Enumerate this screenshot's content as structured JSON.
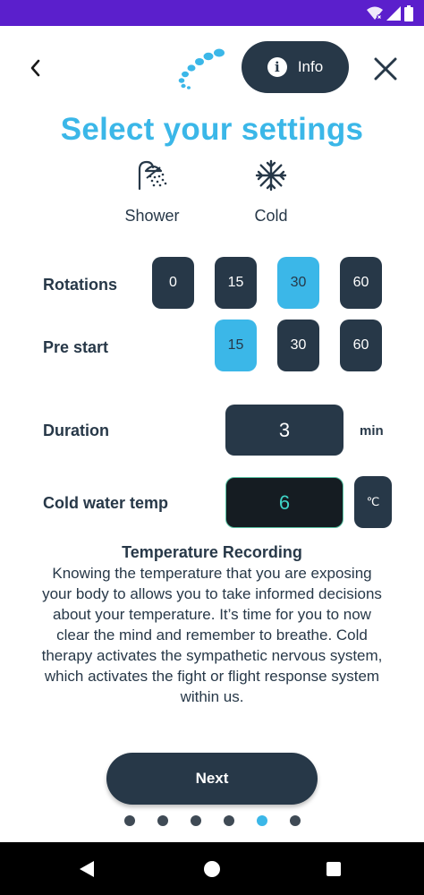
{
  "header": {
    "back_icon": "chevron-left-icon",
    "logo_icon": "water-drops-logo-icon",
    "info_label": "Info",
    "info_icon_glyph": "i",
    "close_icon": "close-icon"
  },
  "title": "Select your settings",
  "modes": {
    "shower": {
      "label": "Shower",
      "icon": "shower-icon"
    },
    "cold": {
      "label": "Cold",
      "icon": "snowflake-icon"
    }
  },
  "rotations": {
    "label": "Rotations",
    "options": [
      "0",
      "15",
      "30",
      "60"
    ],
    "selected": "30"
  },
  "pre_start": {
    "label": "Pre start",
    "options": [
      "15",
      "30",
      "60"
    ],
    "selected": "15"
  },
  "duration": {
    "label": "Duration",
    "value": "3",
    "unit": "min"
  },
  "cold_temp": {
    "label": "Cold water temp",
    "value": "6",
    "unit": "℃"
  },
  "info": {
    "title": "Temperature Recording",
    "body": "Knowing the temperature that you are exposing your body to allows you to take informed decisions about your temperature. It’s time for you to now clear the mind and remember to breathe. Cold therapy activates the sympathetic nervous system, which activates the fight or flight response system within us."
  },
  "next_label": "Next",
  "pagination": {
    "total": 6,
    "active_index": 4
  },
  "colors": {
    "accent": "#3bb7e8",
    "dark": "#273848",
    "temp_value": "#3fd3c6",
    "status_bar": "#5b1fcc"
  }
}
